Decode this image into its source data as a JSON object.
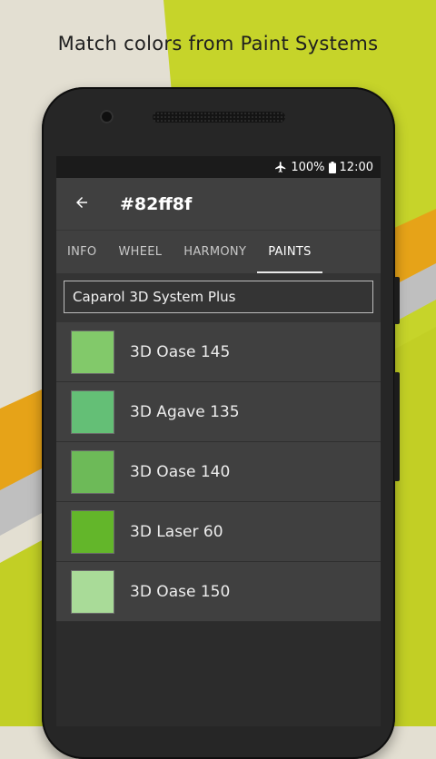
{
  "caption": "Match colors from Paint Systems",
  "colors": {
    "background": "#e3dfd2",
    "lime": "#c6d42a",
    "orange": "#e6a318",
    "silver": "#bfbfbf",
    "app_bar": "#404040",
    "screen": "#2c2c2c"
  },
  "status_bar": {
    "battery": "100%",
    "time": "12:00",
    "icons": [
      "airplane-icon",
      "battery-icon"
    ]
  },
  "toolbar": {
    "back_icon": "arrow-left-icon",
    "title": "#82ff8f"
  },
  "tabs": [
    {
      "label": "INFO",
      "active": false
    },
    {
      "label": "WHEEL",
      "active": false
    },
    {
      "label": "HARMONY",
      "active": false
    },
    {
      "label": "PAINTS",
      "active": true
    }
  ],
  "paint_system": {
    "selected": "Caparol 3D System Plus"
  },
  "paints": [
    {
      "name": "3D Oase 145",
      "color": "#82c96a"
    },
    {
      "name": "3D Agave 135",
      "color": "#64bf76"
    },
    {
      "name": "3D Oase 140",
      "color": "#6dba58"
    },
    {
      "name": "3D Laser 60",
      "color": "#63b62a"
    },
    {
      "name": "3D Oase 150",
      "color": "#a9db98"
    }
  ]
}
